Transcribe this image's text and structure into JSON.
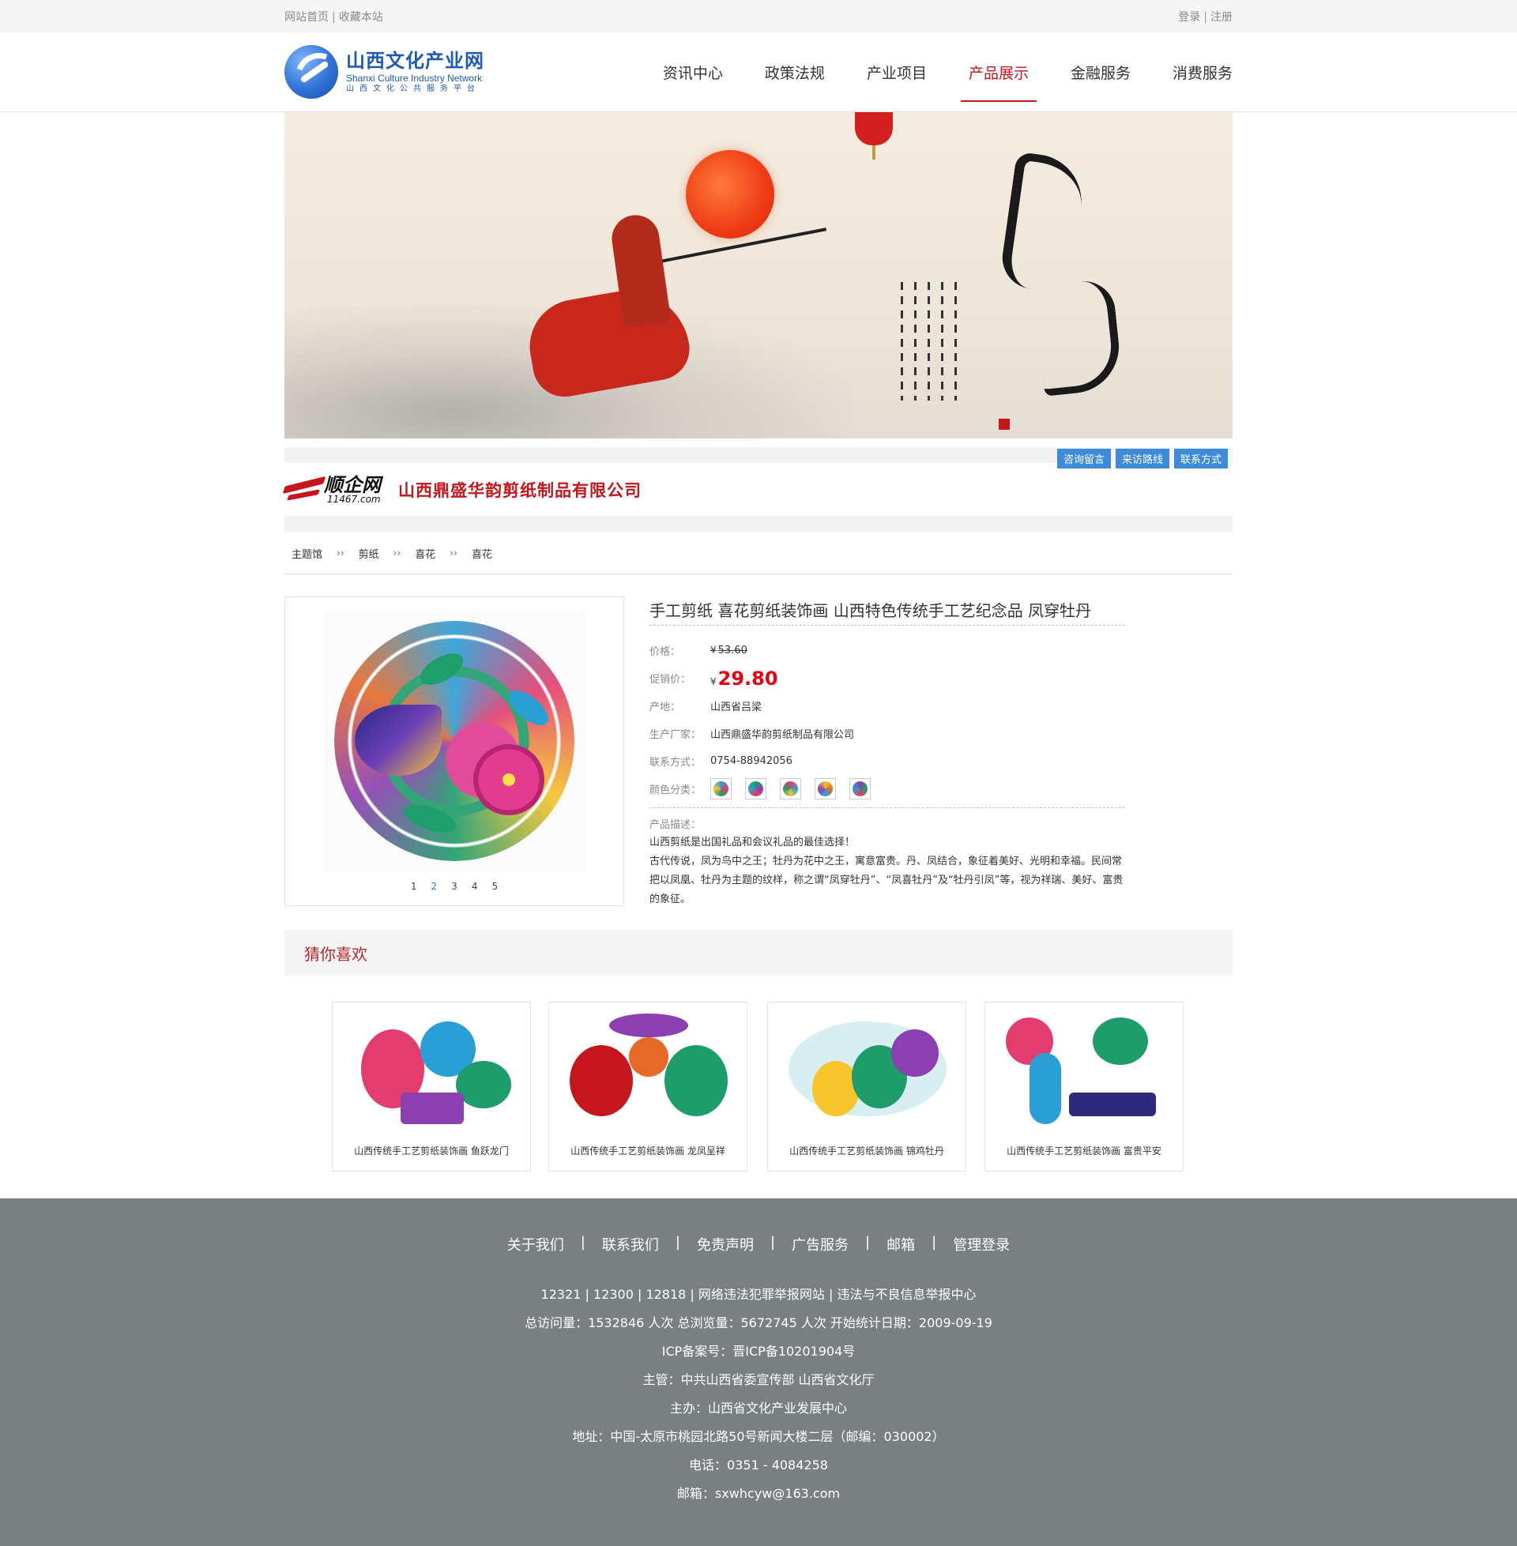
{
  "topbar": {
    "home": "网站首页",
    "favorite": "收藏本站",
    "login": "登录",
    "register": "注册",
    "sep": "|"
  },
  "logo": {
    "cn": "山西文化产业网",
    "en": "Shanxi Culture Industry Network",
    "sub": "山西文化公共服务平台"
  },
  "nav": [
    "资讯中心",
    "政策法规",
    "产业项目",
    "产品展示",
    "金融服务",
    "消费服务"
  ],
  "company": {
    "brand_cn": "顺企网",
    "brand_en": "11467.com",
    "name": "山西鼎盛华韵剪纸制品有限公司",
    "buttons": [
      "咨询留言",
      "来访路线",
      "联系方式"
    ]
  },
  "breadcrumb": [
    "主题馆",
    "剪纸",
    "喜花",
    "喜花"
  ],
  "breadcrumb_sep": "››",
  "product": {
    "title": "手工剪纸  喜花剪纸装饰画 山西特色传统手工艺纪念品 凤穿牡丹",
    "pager": [
      "1",
      "2",
      "3",
      "4",
      "5"
    ],
    "current_page": 2,
    "price_label": "价格：",
    "price_yen": "¥",
    "price": "53.60",
    "promo_label": "促销价：",
    "promo_yen": "¥",
    "promo_price": "29.80",
    "origin_label": "产地：",
    "origin": "山西省吕梁",
    "maker_label": "生产厂家：",
    "maker": "山西鼎盛华韵剪纸制品有限公司",
    "contact_label": "联系方式：",
    "contact": "0754-88942056",
    "color_label": "颜色分类：",
    "desc_label": "产品描述：",
    "desc": [
      "山西剪纸是出国礼品和会议礼品的最佳选择！",
      "古代传说，凤为鸟中之王；牡丹为花中之王，寓意富贵。丹、凤结合，象征着美好、光明和幸福。民间常把以凤凰、牡丹为主题的纹样，称之谓“凤穿牡丹”、“凤喜牡丹”及“牡丹引凤”等，视为祥瑞、美好、富贵的象征。"
    ]
  },
  "guess": {
    "title": "猜你喜欢",
    "items": [
      {
        "caption": "山西传统手工艺剪纸装饰画 鱼跃龙门"
      },
      {
        "caption": "山西传统手工艺剪纸装饰画 龙凤呈祥"
      },
      {
        "caption": "山西传统手工艺剪纸装饰画 锦鸡牡丹"
      },
      {
        "caption": "山西传统手工艺剪纸装饰画 富贵平安"
      }
    ]
  },
  "footer": {
    "links": [
      "关于我们",
      "联系我们",
      "免责声明",
      "广告服务",
      "邮箱",
      "管理登录"
    ],
    "sep": "|",
    "lines": [
      "12321 | 12300 | 12818 | 网络违法犯罪举报网站 | 违法与不良信息举报中心",
      "总访问量：1532846 人次  总浏览量：5672745 人次  开始统计日期：2009-09-19",
      "ICP备案号：晋ICP备10201904号",
      "主管：中共山西省委宣传部 山西省文化厅",
      "主办：山西省文化产业发展中心",
      "地址：中国-太原市桃园北路50号新闻大楼二层（邮编：030002）",
      "电话：0351 - 4084258",
      "邮箱：sxwhcyw@163.com"
    ]
  },
  "colors": {
    "accent_red": "#c4161c",
    "promo_red": "#e60012",
    "button_blue": "#3e8bdc",
    "footer_bg": "#7a7f82"
  }
}
